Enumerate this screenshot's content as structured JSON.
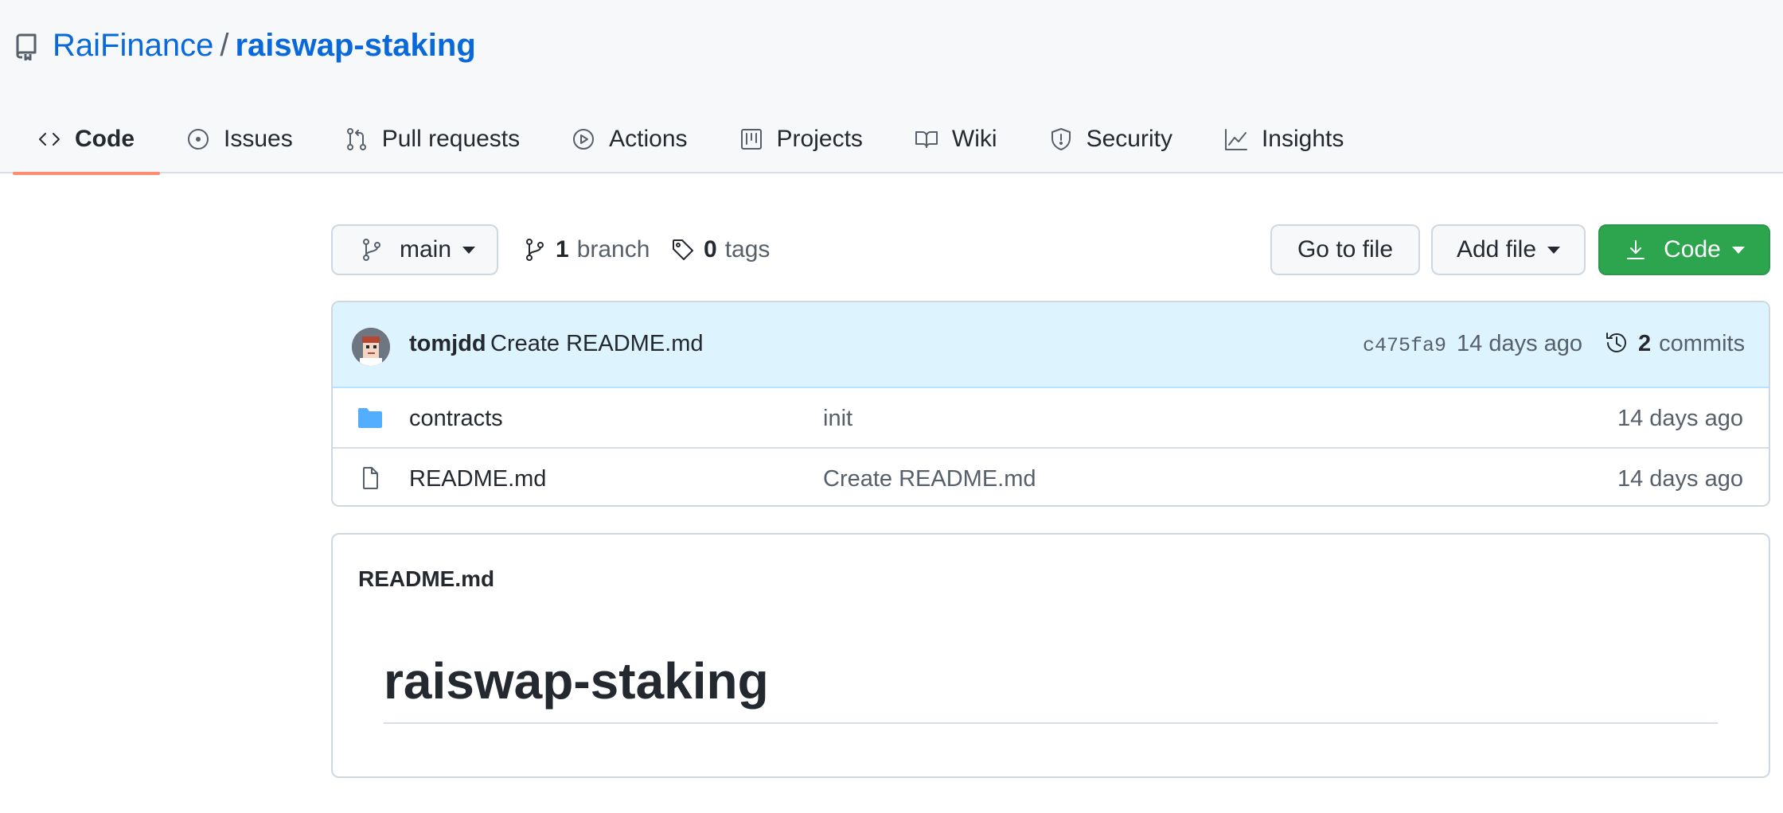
{
  "repo": {
    "owner": "RaiFinance",
    "separator": "/",
    "name": "raiswap-staking"
  },
  "tabs": [
    {
      "label": "Code",
      "icon": "code-icon",
      "active": true
    },
    {
      "label": "Issues",
      "icon": "issue-icon"
    },
    {
      "label": "Pull requests",
      "icon": "pull-request-icon"
    },
    {
      "label": "Actions",
      "icon": "play-icon"
    },
    {
      "label": "Projects",
      "icon": "project-board-icon"
    },
    {
      "label": "Wiki",
      "icon": "book-icon"
    },
    {
      "label": "Security",
      "icon": "shield-icon"
    },
    {
      "label": "Insights",
      "icon": "graph-icon"
    }
  ],
  "toolbar": {
    "branch": "main",
    "branch_count": "1",
    "branch_label": "branch",
    "tag_count": "0",
    "tag_label": "tags",
    "go_to_file": "Go to file",
    "add_file": "Add file",
    "code": "Code"
  },
  "latest_commit": {
    "author": "tomjdd",
    "message": "Create README.md",
    "sha": "c475fa9",
    "age": "14 days ago",
    "commit_count": "2",
    "commit_label": "commits"
  },
  "files": [
    {
      "type": "folder",
      "name": "contracts",
      "commit": "init",
      "age": "14 days ago"
    },
    {
      "type": "file",
      "name": "README.md",
      "commit": "Create README.md",
      "age": "14 days ago"
    }
  ],
  "readme": {
    "label": "README.md",
    "heading": "raiswap-staking"
  },
  "colors": {
    "link": "#0969da",
    "primary_button": "#2da44e",
    "active_tab_underline": "#fd8c73",
    "commit_bar": "#ddf4ff",
    "folder": "#54aeff"
  }
}
